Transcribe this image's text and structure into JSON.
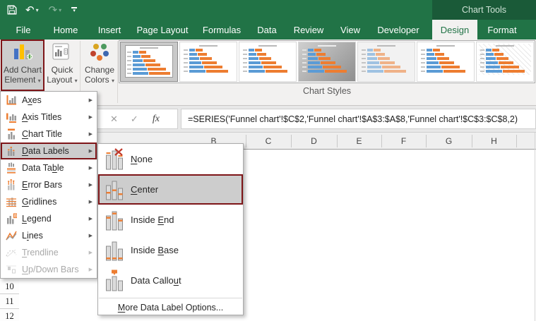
{
  "titlebar": {
    "contextual_label": "Chart Tools"
  },
  "icons": {
    "undo": "↶",
    "redo": "↷",
    "caret_down": "▾",
    "menu_arrow": "▶",
    "cancel": "✕",
    "enter": "✓",
    "fx": "fx"
  },
  "tabs": {
    "active": "Design",
    "items": [
      "File",
      "Home",
      "Insert",
      "Page Layout",
      "Formulas",
      "Data",
      "Review",
      "View",
      "Developer",
      "Design",
      "Format"
    ]
  },
  "ribbon": {
    "add_chart_element": {
      "line1": "Add Chart",
      "line2": "Element"
    },
    "quick_layout": {
      "line1": "Quick",
      "line2": "Layout"
    },
    "change_colors": {
      "line1": "Change",
      "line2": "Colors"
    },
    "group_label": "Chart Styles",
    "gallery": {
      "bar_rows": [
        [
          8,
          10
        ],
        [
          11,
          13
        ],
        [
          14,
          17
        ],
        [
          17,
          21
        ],
        [
          20,
          26
        ],
        [
          23,
          31
        ]
      ],
      "styles": [
        {
          "name": "style-1",
          "selected": true,
          "bg": "#c9c9c9",
          "card": true
        },
        {
          "name": "style-2",
          "bg": "#ffffff"
        },
        {
          "name": "style-3",
          "bg": "#ffffff"
        },
        {
          "name": "style-4",
          "bg": "linear-gradient(135deg,#cfcfcf,#8f8f8f)",
          "dark": true
        },
        {
          "name": "style-5",
          "bg": "#f2f2f2",
          "muted": true
        },
        {
          "name": "style-6",
          "bg": "#ffffff"
        },
        {
          "name": "style-7",
          "bg": "#ffffff",
          "hatch": true
        }
      ]
    }
  },
  "formula_bar": {
    "formula": "=SERIES('Funnel chart'!$C$2,'Funnel chart'!$A$3:$A$8,'Funnel chart'!$C$3:$C$8,2)"
  },
  "sheet": {
    "columns": [
      "B",
      "C",
      "D",
      "E",
      "F",
      "G",
      "H"
    ],
    "rows": [
      "10",
      "11",
      "12"
    ]
  },
  "menu": {
    "items": [
      {
        "label": "Axes",
        "ul": 1
      },
      {
        "label": "Axis Titles",
        "ul": 0
      },
      {
        "label": "Chart Title",
        "ul": 0
      },
      {
        "label": "Data Labels",
        "ul": 0,
        "highlighted": true
      },
      {
        "label": "Data Table",
        "ul": 7
      },
      {
        "label": "Error Bars",
        "ul": 0
      },
      {
        "label": "Gridlines",
        "ul": 0
      },
      {
        "label": "Legend",
        "ul": 0
      },
      {
        "label": "Lines",
        "ul": 1
      },
      {
        "label": "Trendline",
        "ul": 0,
        "disabled": true
      },
      {
        "label": "Up/Down Bars",
        "ul": 0,
        "disabled": true
      }
    ]
  },
  "submenu": {
    "items": [
      {
        "label": "None",
        "ul": 0
      },
      {
        "label": "Center",
        "ul": 0,
        "highlighted": true
      },
      {
        "label": "Inside End",
        "ul": 7
      },
      {
        "label": "Inside Base",
        "ul": 7
      },
      {
        "label": "Data Callout",
        "ul": 10
      }
    ],
    "footer": {
      "label": "More Data Label Options...",
      "ul": 0
    }
  },
  "colors": {
    "excel_green": "#217346",
    "contextual_dark_green": "#1A5A38",
    "annotation_red": "#7E1518",
    "series_blue": "#5B9BD5",
    "series_orange": "#ED7D31"
  }
}
